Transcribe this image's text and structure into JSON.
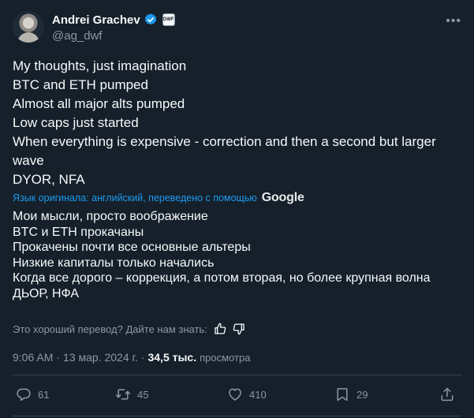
{
  "author": {
    "name": "Andrei Grachev",
    "handle": "@ag_dwf",
    "org_badge_text": "DWF"
  },
  "tweet": {
    "lines": [
      "My thoughts, just imagination",
      "BTC and ETH pumped",
      "Almost all major alts pumped",
      "Low caps just started",
      "When everything is expensive - correction and then a second but larger",
      "wave",
      "DYOR, NFA"
    ]
  },
  "translation": {
    "label": "Язык оригинала: английский, переведено с помощью",
    "provider": "Google",
    "lines": [
      "Мои мысли, просто воображение",
      "BTC и ETH прокачаны",
      "Прокачены почти все основные альтеры",
      "Низкие капиталы только начались",
      "Когда все дорого – коррекция, а потом вторая, но более крупная волна",
      "ДЬОР, НФА"
    ],
    "rate_prompt": "Это хороший перевод? Дайте нам знать:"
  },
  "meta": {
    "time": "9:06 AM",
    "separator": "·",
    "date": "13 мар. 2024 г.",
    "views_count": "34,5 тыс.",
    "views_label": "просмотра"
  },
  "actions": {
    "replies": "61",
    "reposts": "45",
    "likes": "410",
    "bookmarks": "29"
  },
  "colors": {
    "background": "#15202b",
    "text": "#f7f9f9",
    "secondary": "#8b98a5",
    "accent": "#1d9bf0",
    "divider": "#38444d"
  }
}
